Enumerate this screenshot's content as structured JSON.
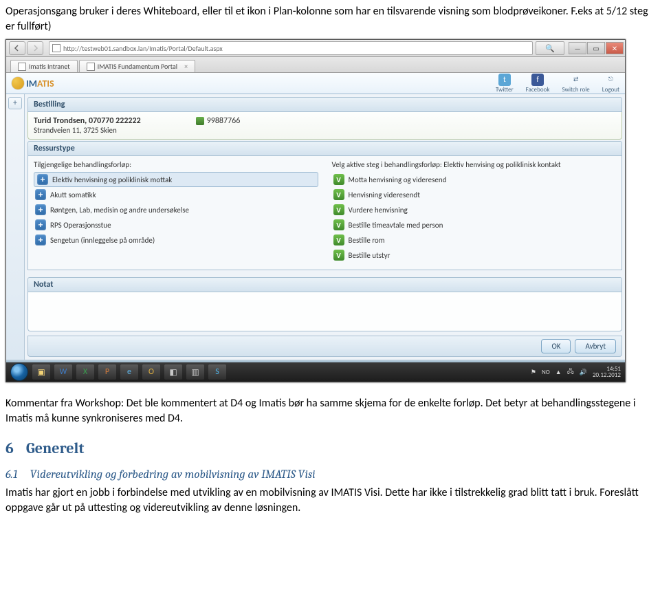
{
  "intro_para": "Operasjonsgang bruker i deres Whiteboard, eller til et ikon i Plan-kolonne som har en tilsvarende visning som blodprøveikoner. F.eks at 5/12 steg er fullført)",
  "kommentar_para": "Kommentar fra Workshop: Det ble kommentert at D4 og Imatis bør ha samme skjema for de enkelte forløp. Det betyr at behandlingsstegene i Imatis må kunne synkroniseres med D4.",
  "h6_num": "6",
  "h6_title": "Generelt",
  "h61_num": "6.1",
  "h61_title": "Videreutvikling og forbedring av mobilvisning av IMATIS Visi",
  "body_61": "Imatis har gjort en jobb i forbindelse med utvikling av en mobilvisning av IMATIS Visi. Dette har ikke i tilstrekkelig grad blitt tatt i bruk. Foreslått oppgave går ut på uttesting og videreutvikling av denne løsningen.",
  "browser": {
    "url": "http://testweb01.sandbox.lan/Imatis/Portal/Default.aspx",
    "search_hint": "🔍",
    "tab1": "Imatis Intranet",
    "tab2": "IMATIS Fundamentum Portal"
  },
  "imatis": {
    "brand_im": "IM",
    "brand_atis": "ATIS",
    "top_icons": {
      "twitter": "Twitter",
      "facebook": "Facebook",
      "switch": "Switch role",
      "logout": "Logout"
    }
  },
  "sections": {
    "bestilling": "Bestilling",
    "ressurstype": "Ressurstype",
    "notat": "Notat"
  },
  "patient": {
    "name": "Turid Trondsen, 070770 222222",
    "address": "Strandveien 11, 3725 Skien",
    "phone": "99887766"
  },
  "left_title": "Tilgjengelige behandlingsforløp:",
  "right_title": "Velg aktive steg i behandlingsforløp: Elektiv henvising og poliklinisk kontakt",
  "left_items": [
    "Elektiv henvisning og poliklinisk mottak",
    "Akutt somatikk",
    "Røntgen, Lab, medisin og andre undersøkelse",
    "RPS Operasjonsstue",
    "Sengetun (innleggelse på område)"
  ],
  "right_items": [
    "Motta henvisning og videresend",
    "Henvisning videresendt",
    "Vurdere henvisning",
    "Bestille timeavtale med person",
    "Bestille rom",
    "Bestille utstyr"
  ],
  "buttons": {
    "ok": "OK",
    "cancel": "Avbryt"
  },
  "taskbar": {
    "lang": "NO",
    "time": "14:51",
    "date": "20.12.2012"
  }
}
